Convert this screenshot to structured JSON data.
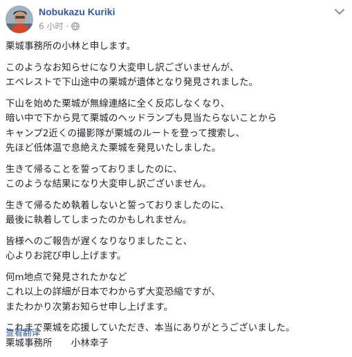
{
  "post": {
    "author_name": "Nobukazu Kuriki",
    "timestamp": "6 小时",
    "separator": "·",
    "privacy_icon": "globe-icon",
    "menu_icon": "chevron-down-icon",
    "paragraphs": [
      [
        "栗城事務所の小林と申します。"
      ],
      [
        "このようなお知らせになり大変申し訳ございませんが、",
        "エベレストで下山途中の栗城が遺体となり発見されました。"
      ],
      [
        "下山を始めた栗城が無線連絡に全く反応しなくなり、",
        "暗い中で下から見て栗城のヘッドランプも見当たらないことから",
        "キャンプ2近くの撮影隊が栗城のルートを登って捜索し、",
        "先ほど低体温で息絶えた栗城を発見いたしました。"
      ],
      [
        "生きて帰ることを誓っておりましたのに、",
        "このような結果になり大変申し訳ございません。"
      ],
      [
        "生きて帰るため執着しないと誓っておりましたのに、",
        "最後に執着してしまったのかもしれません。"
      ],
      [
        "皆様へのご報告が遅くなりなりましたこと、",
        "心よりお詫び申し上げます。"
      ],
      [
        "何m地点で発見されたかなど",
        "これ以上の詳細が日本でわからず大変恐縮ですが、",
        "またわかり次第お知らせ申し上げます。"
      ],
      [
        "これまで栗城を応援していただき、本当にありがとうございました。"
      ]
    ],
    "signature": "栗城事務所　　小林幸子",
    "translate_link": "查看翻译"
  },
  "colors": {
    "link_blue": "#365899",
    "text": "#1d2129",
    "meta_gray": "#90949c"
  }
}
